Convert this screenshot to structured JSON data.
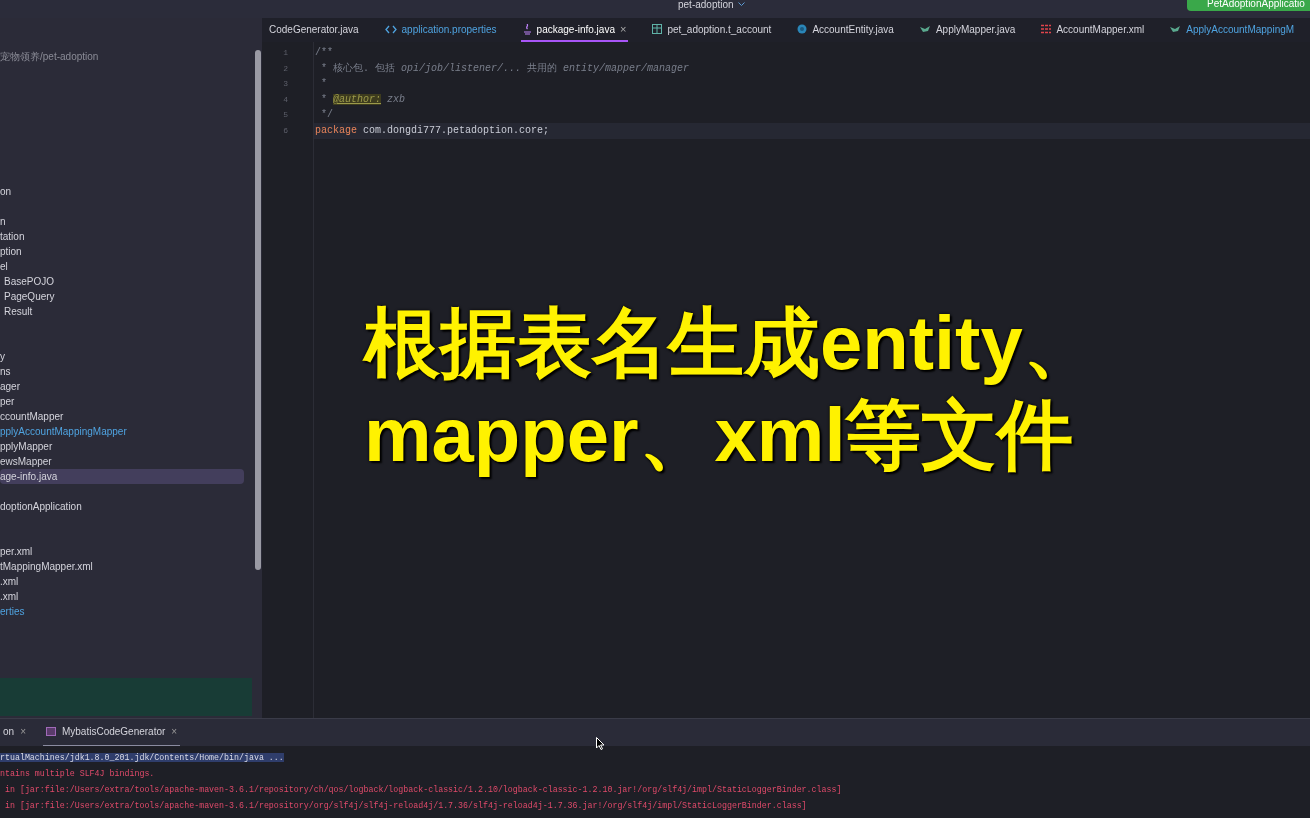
{
  "top_bar": {
    "project": "pet-adoption",
    "run_config": "PetAdoptionApplicatio"
  },
  "project_tree": {
    "path": "宠物领养/pet-adoption",
    "groups": [
      [
        {
          "label": "on",
          "modified": false,
          "selected": false
        }
      ],
      [
        {
          "label": "n",
          "modified": false,
          "selected": false
        },
        {
          "label": "tation",
          "modified": false,
          "selected": false
        },
        {
          "label": "ption",
          "modified": false,
          "selected": false
        },
        {
          "label": "el",
          "modified": false,
          "selected": false,
          "children": [
            {
              "label": "BasePOJO",
              "modified": false,
              "selected": false
            },
            {
              "label": "PageQuery",
              "modified": false,
              "selected": false
            },
            {
              "label": "Result",
              "modified": false,
              "selected": false
            }
          ]
        }
      ],
      [
        {
          "label": "y",
          "modified": false,
          "selected": false
        },
        {
          "label": "ns",
          "modified": false,
          "selected": false
        },
        {
          "label": "ager",
          "modified": false,
          "selected": false
        },
        {
          "label": "per",
          "modified": false,
          "selected": false
        },
        {
          "label": "ccountMapper",
          "modified": false,
          "selected": false
        },
        {
          "label": "pplyAccountMappingMapper",
          "modified": true,
          "selected": false
        },
        {
          "label": "pplyMapper",
          "modified": false,
          "selected": false
        },
        {
          "label": "ewsMapper",
          "modified": false,
          "selected": false
        },
        {
          "label": "age-info.java",
          "modified": false,
          "selected": true
        }
      ],
      [
        {
          "label": "doptionApplication",
          "modified": false,
          "selected": false
        }
      ],
      [
        {
          "label": "per.xml",
          "modified": false,
          "selected": false
        },
        {
          "label": "tMappingMapper.xml",
          "modified": false,
          "selected": false
        },
        {
          "label": ".xml",
          "modified": false,
          "selected": false
        },
        {
          "label": ".xml",
          "modified": false,
          "selected": false
        },
        {
          "label": "erties",
          "modified": true,
          "selected": false
        }
      ]
    ]
  },
  "editor_tabs": [
    {
      "label": "CodeGenerator.java",
      "kind": "none",
      "modified": false,
      "selected": false
    },
    {
      "label": "application.properties",
      "kind": "code",
      "modified": true,
      "selected": false
    },
    {
      "label": "package-info.java",
      "kind": "java",
      "modified": false,
      "selected": true,
      "close": "×"
    },
    {
      "label": "pet_adoption.t_account",
      "kind": "table",
      "modified": false,
      "selected": false
    },
    {
      "label": "AccountEntity.java",
      "kind": "class",
      "modified": false,
      "selected": false
    },
    {
      "label": "ApplyMapper.java",
      "kind": "mapper",
      "modified": false,
      "selected": false
    },
    {
      "label": "AccountMapper.xml",
      "kind": "xml",
      "modified": false,
      "selected": false
    },
    {
      "label": "ApplyAccountMappingM",
      "kind": "mapper",
      "modified": true,
      "selected": false
    }
  ],
  "code_lines": [
    {
      "number": "1",
      "current": false,
      "segments": [
        {
          "text": "/**",
          "kind": "comment"
        }
      ]
    },
    {
      "number": "2",
      "current": false,
      "segments": [
        {
          "text": " * 核心包. 包括 ",
          "kind": "comment"
        },
        {
          "text": "opi/job/listener/...",
          "kind": "comment_italic"
        },
        {
          "text": " 共用的 ",
          "kind": "comment"
        },
        {
          "text": "entity/mapper/manager",
          "kind": "comment_italic"
        }
      ]
    },
    {
      "number": "3",
      "current": false,
      "segments": [
        {
          "text": " *",
          "kind": "comment"
        }
      ]
    },
    {
      "number": "4",
      "current": false,
      "segments": [
        {
          "text": " * ",
          "kind": "comment"
        },
        {
          "text": "@author:",
          "kind": "tag"
        },
        {
          "text": " zxb",
          "kind": "comment_italic"
        }
      ]
    },
    {
      "number": "5",
      "current": false,
      "segments": [
        {
          "text": " */",
          "kind": "comment"
        }
      ]
    },
    {
      "number": "6",
      "current": true,
      "segments": [
        {
          "text": "package",
          "kind": "keyword"
        },
        {
          "text": " com.dongdi777.petadoption.core;",
          "kind": "plain"
        }
      ]
    }
  ],
  "caption": [
    "根据表名生成entity、",
    "mapper、xml等文件"
  ],
  "bottom_tabs": [
    {
      "label": "on",
      "selected": false,
      "close": "×"
    },
    {
      "label": "MybatisCodeGenerator",
      "selected": true,
      "close": "×"
    }
  ],
  "console_lines": [
    {
      "text": "rtualMachines/jdk1.8.0_201.jdk/Contents/Home/bin/java ...",
      "kind": "command"
    },
    {
      "text": "ntains multiple SLF4J bindings.",
      "kind": "error"
    },
    {
      "text": " in [jar:file:/Users/extra/tools/apache-maven-3.6.1/repository/ch/qos/logback/logback-classic/1.2.10/logback-classic-1.2.10.jar!/org/slf4j/impl/StaticLoggerBinder.class]",
      "kind": "error"
    },
    {
      "text": " in [jar:file:/Users/extra/tools/apache-maven-3.6.1/repository/org/slf4j/slf4j-reload4j/1.7.36/slf4j-reload4j-1.7.36.jar!/org/slf4j/impl/StaticLoggerBinder.class]",
      "kind": "error"
    }
  ]
}
